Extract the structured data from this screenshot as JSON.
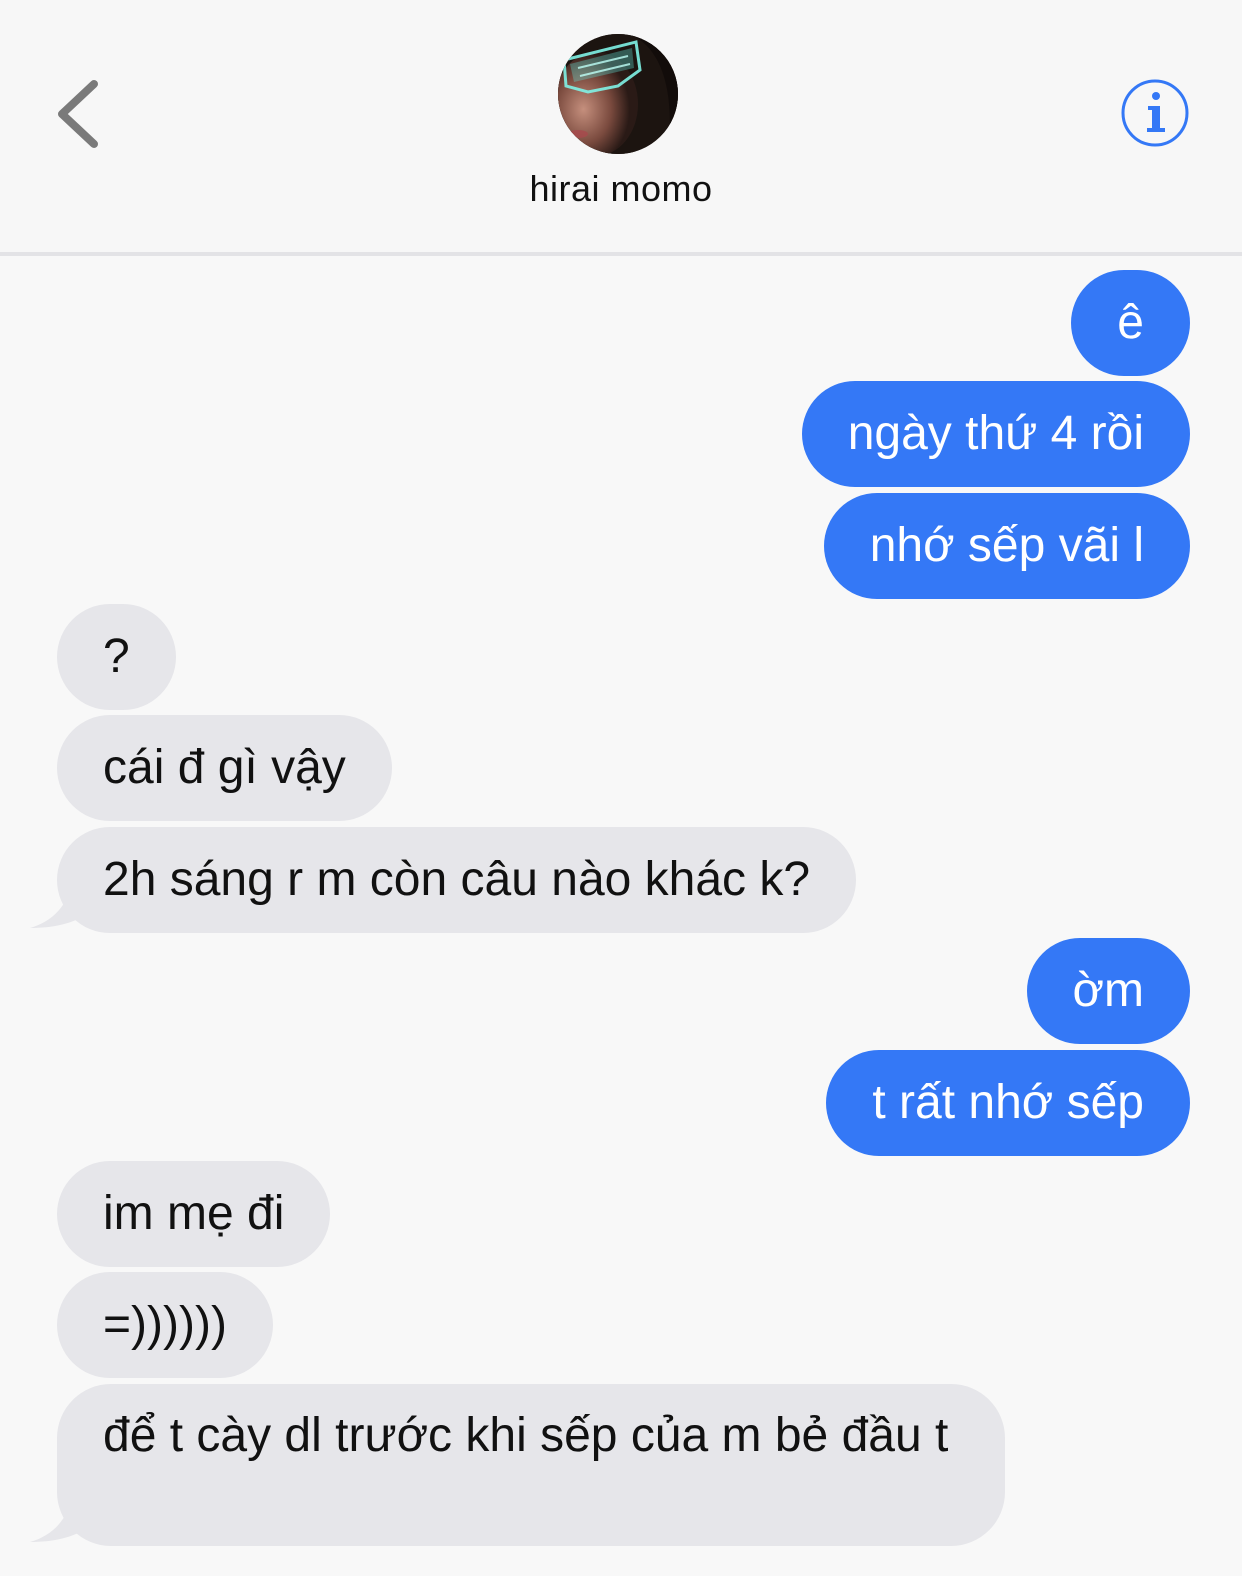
{
  "header": {
    "contact_name": "hirai momo",
    "back_icon": "chevron-left-icon",
    "info_icon": "info-circle-icon",
    "accent": "#3478f6"
  },
  "messages": [
    {
      "direction": "outgoing",
      "text": "ê"
    },
    {
      "direction": "outgoing",
      "text": "ngày thứ 4 rồi"
    },
    {
      "direction": "outgoing",
      "text": "nhớ sếp vãi l"
    },
    {
      "direction": "incoming",
      "text": "?"
    },
    {
      "direction": "incoming",
      "text": "cái đ gì vậy"
    },
    {
      "direction": "incoming",
      "text": "2h sáng r m còn câu nào khác k?"
    },
    {
      "direction": "outgoing",
      "text": "ờm"
    },
    {
      "direction": "outgoing",
      "text": "t rất nhớ sếp"
    },
    {
      "direction": "incoming",
      "text": "im mẹ đi"
    },
    {
      "direction": "incoming",
      "text": "=))))))"
    },
    {
      "direction": "incoming",
      "text": "để t cày dl trước khi sếp của m bẻ đầu t"
    }
  ],
  "colors": {
    "outgoing_bubble": "#3478f6",
    "incoming_bubble": "#e6e6ea",
    "background": "#f8f8f8"
  }
}
